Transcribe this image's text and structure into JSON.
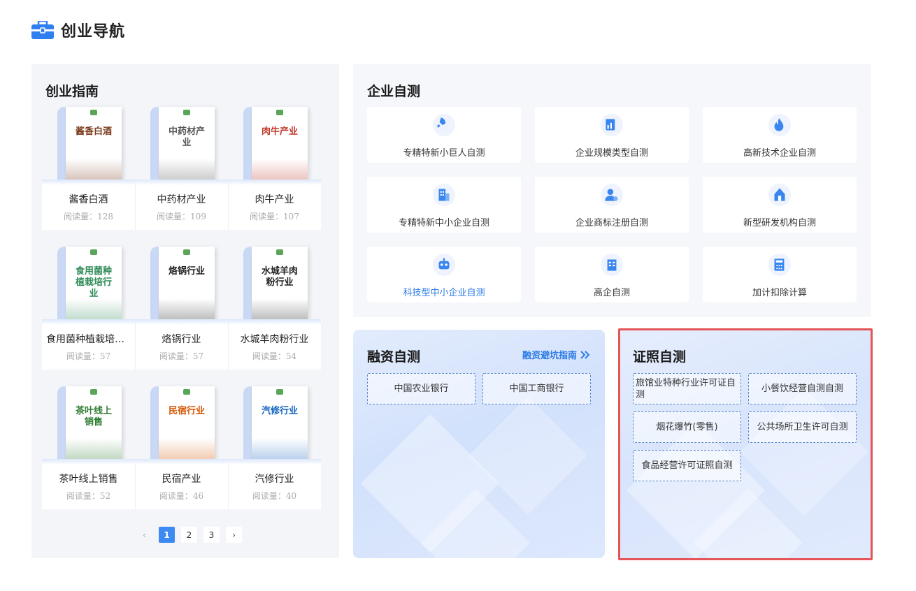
{
  "header": {
    "title": "创业导航",
    "icon": "briefcase-icon"
  },
  "guide": {
    "title": "创业指南",
    "books": [
      {
        "name": "酱香白酒",
        "reads": "阅读量：128",
        "cover_title": "酱香白酒",
        "cover_color": "#7a3b1b"
      },
      {
        "name": "中药材产业",
        "reads": "阅读量：109",
        "cover_title": "中药材产业",
        "cover_color": "#555555"
      },
      {
        "name": "肉牛产业",
        "reads": "阅读量：107",
        "cover_title": "肉牛产业",
        "cover_color": "#c0392b"
      },
      {
        "name": "食用菌种植栽培行业",
        "reads": "阅读量：57",
        "cover_title": "食用菌种植栽培行业",
        "cover_color": "#2e8b57"
      },
      {
        "name": "烙锅行业",
        "reads": "阅读量：57",
        "cover_title": "烙锅行业",
        "cover_color": "#222222"
      },
      {
        "name": "水城羊肉粉行业",
        "reads": "阅读量：54",
        "cover_title": "水城羊肉粉行业",
        "cover_color": "#222222"
      },
      {
        "name": "茶叶线上销售",
        "reads": "阅读量：52",
        "cover_title": "茶叶线上销售",
        "cover_color": "#2e7d32"
      },
      {
        "name": "民宿产业",
        "reads": "阅读量：46",
        "cover_title": "民宿行业",
        "cover_color": "#d35400"
      },
      {
        "name": "汽修行业",
        "reads": "阅读量：40",
        "cover_title": "汽修行业",
        "cover_color": "#1565c0"
      }
    ],
    "pagination": {
      "prev": "‹",
      "pages": [
        "1",
        "2",
        "3"
      ],
      "current": "1",
      "next": "›"
    }
  },
  "selftest": {
    "title": "企业自测",
    "items": [
      {
        "label": "专精特新小巨人自测",
        "icon": "rocket-icon"
      },
      {
        "label": "企业规模类型自测",
        "icon": "chart-doc-icon"
      },
      {
        "label": "高新技术企业自测",
        "icon": "flame-icon"
      },
      {
        "label": "专精特新中小企业自测",
        "icon": "building-icon"
      },
      {
        "label": "企业商标注册自测",
        "icon": "user-badge-icon"
      },
      {
        "label": "新型研发机构自测",
        "icon": "institution-icon"
      },
      {
        "label": "科技型中小企业自测",
        "icon": "robot-icon"
      },
      {
        "label": "高企自测",
        "icon": "office-icon"
      },
      {
        "label": "加计扣除计算",
        "icon": "calculator-icon"
      }
    ],
    "active_index": 6
  },
  "finance": {
    "title": "融资自测",
    "guide_link": "融资避坑指南",
    "banks": [
      "中国农业银行",
      "中国工商银行"
    ]
  },
  "license": {
    "title": "证照自测",
    "items": [
      "旅馆业特种行业许可证自测",
      "小餐饮经营自测自测",
      "烟花爆竹(零售)",
      "公共场所卫生许可自测",
      "食品经营许可证照自测"
    ]
  },
  "colors": {
    "accent": "#2b7be5",
    "active_page": "#3d8bf2",
    "highlight": "#e45557"
  }
}
